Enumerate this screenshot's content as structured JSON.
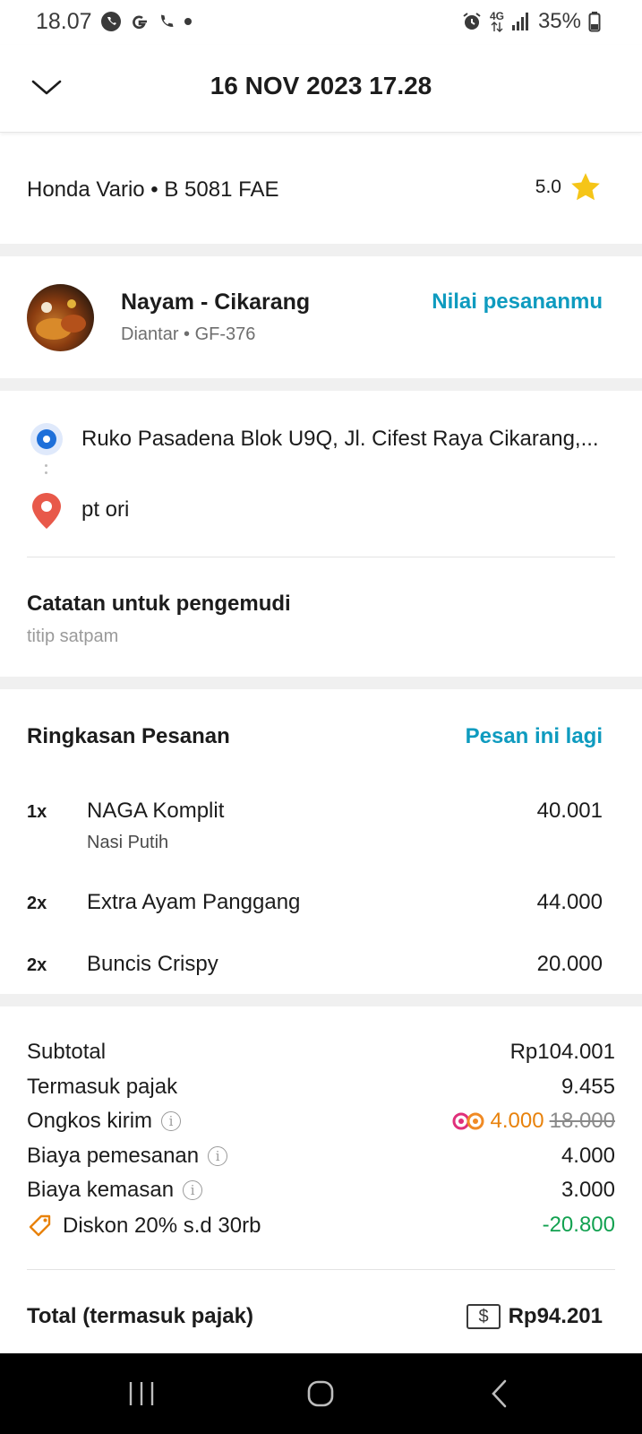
{
  "status_bar": {
    "time": "18.07",
    "network": "4G",
    "battery": "35%",
    "icons": [
      "whatsapp-icon",
      "google-icon",
      "phone-icon",
      "dot-icon",
      "alarm-icon",
      "data-arrows-icon",
      "signal-icon",
      "battery-icon"
    ]
  },
  "header": {
    "title": "16 NOV 2023 17.28",
    "back_icon": "chevron-down-icon"
  },
  "driver": {
    "vehicle": "Honda Vario • B 5081 FAE",
    "rating": "5.0"
  },
  "restaurant": {
    "name": "Nayam - Cikarang",
    "subtitle": "Diantar • GF-376",
    "rate_link": "Nilai pesananmu"
  },
  "route": {
    "pickup": "Ruko Pasadena Blok U9Q, Jl. Cifest Raya Cikarang,...",
    "destination": "pt ori"
  },
  "note": {
    "title": "Catatan untuk pengemudi",
    "text": "titip satpam"
  },
  "summary": {
    "title": "Ringkasan Pesanan",
    "reorder": "Pesan ini lagi",
    "items": [
      {
        "qty": "1x",
        "name": "NAGA Komplit",
        "sub": "Nasi Putih",
        "price": "40.001"
      },
      {
        "qty": "2x",
        "name": "Extra Ayam Panggang",
        "sub": "",
        "price": "44.000"
      },
      {
        "qty": "2x",
        "name": "Buncis Crispy",
        "sub": "",
        "price": "20.000"
      }
    ]
  },
  "payment": {
    "subtotal_label": "Subtotal",
    "subtotal": "Rp104.001",
    "tax_label": "Termasuk pajak",
    "tax": "9.455",
    "delivery_label": "Ongkos kirim",
    "delivery": "4.000",
    "delivery_original": "18.000",
    "order_fee_label": "Biaya pemesanan",
    "order_fee": "4.000",
    "packaging_label": "Biaya kemasan",
    "packaging": "3.000",
    "discount_label": "Diskon 20% s.d 30rb",
    "discount": "-20.800",
    "total_label": "Total (termasuk pajak)",
    "total": "Rp94.201"
  },
  "colors": {
    "link": "#0e9bbf",
    "discount": "#12a150",
    "promo": "#e8820c",
    "pickup_dot": "#1e6fd9",
    "pin": "#e8594a",
    "star": "#f5c518"
  }
}
